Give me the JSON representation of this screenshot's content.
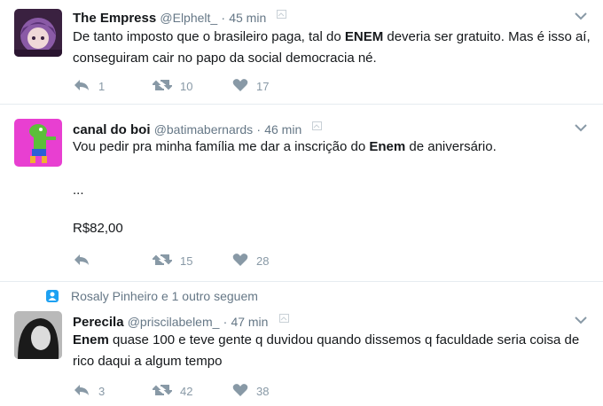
{
  "tweets": [
    {
      "name": "The Empress",
      "handle": "@Elphelt_",
      "sep": "·",
      "time": "45 min",
      "text_parts": [
        "De tanto imposto que o brasileiro paga, tal do ",
        "ENEM",
        " deveria ser gratuito. Mas é isso aí, conseguiram cair no papo da social democracia né."
      ],
      "reply_count": "1",
      "retweet_count": "10",
      "like_count": "17"
    },
    {
      "name": "canal do boi",
      "handle": "@batimabernards",
      "sep": "·",
      "time": "46 min",
      "text_parts": [
        "Vou pedir pra minha família me dar a inscrição do ",
        "Enem",
        " de aniversário."
      ],
      "line2": "...",
      "line3": "R$82,00",
      "reply_count": "",
      "retweet_count": "15",
      "like_count": "28"
    },
    {
      "context": "Rosaly Pinheiro e 1 outro seguem",
      "name": "Perecila",
      "handle": "@priscilabelem_",
      "sep": "·",
      "time": "47 min",
      "text_parts": [
        "Enem",
        " quase 100 e teve gente q duvidou quando dissemos q faculdade seria coisa de rico daqui a algum tempo"
      ],
      "reply_count": "3",
      "retweet_count": "42",
      "like_count": "38"
    }
  ],
  "colors": {
    "text": "#14171a",
    "muted": "#657786",
    "icon": "#8899a6",
    "divider": "#e6ecf0",
    "context_icon": "#1da1f2"
  }
}
